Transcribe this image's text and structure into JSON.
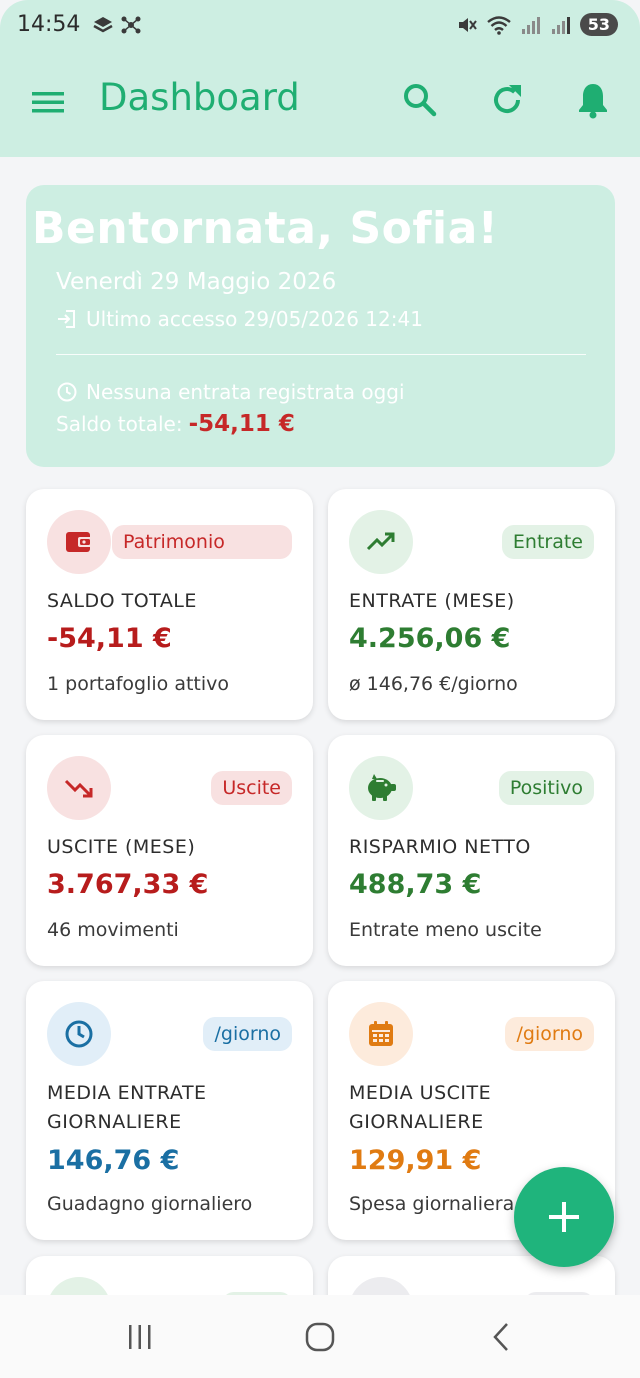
{
  "status_bar": {
    "time": "14:54",
    "battery": "53"
  },
  "app_bar": {
    "title": "Dashboard",
    "accent_color": "#1fae72",
    "background_color": "#cdeee2",
    "icons": [
      "menu-icon",
      "search-icon",
      "refresh-icon",
      "bell-icon"
    ]
  },
  "welcome": {
    "title": "Bentornata, Sofia!",
    "date": "Venerdì 29 Maggio 2026",
    "last_access": "Ultimo accesso 29/05/2026 12:41",
    "no_entries": "Nessuna entrata registrata oggi",
    "balance_label": "Saldo totale:",
    "balance_value": "-54,11 €"
  },
  "cards": [
    {
      "icon": "wallet-icon",
      "badge": "Patrimonio",
      "label": "SALDO TOTALE",
      "value": "-54,11 €",
      "sub": "1 portafoglio attivo",
      "color": "#b71c1c"
    },
    {
      "icon": "trending-up-icon",
      "badge": "Entrate",
      "label": "ENTRATE (MESE)",
      "value": "4.256,06 €",
      "sub": "ø 146,76 €/giorno",
      "color": "#2e7d32"
    },
    {
      "icon": "trending-down-icon",
      "badge": "Uscite",
      "label": "USCITE (MESE)",
      "value": "3.767,33 €",
      "sub": "46 movimenti",
      "color": "#b71c1c"
    },
    {
      "icon": "piggy-bank-icon",
      "badge": "Positivo",
      "label": "RISPARMIO NETTO",
      "value": "488,73 €",
      "sub": "Entrate meno uscite",
      "color": "#2e7d32"
    },
    {
      "icon": "clock-icon",
      "badge": "/giorno",
      "label": "MEDIA ENTRATE GIORNALIERE",
      "value": "146,76 €",
      "sub": "Guadagno giornaliero",
      "color": "#1a6fa3"
    },
    {
      "icon": "calendar-icon",
      "badge": "/giorno",
      "label": "MEDIA USCITE GIORNALIERE",
      "value": "129,91 €",
      "sub": "Spesa giornaliera",
      "color": "#e07b12"
    }
  ],
  "fab": {
    "icon": "plus-icon"
  },
  "nav_bar": {
    "icons": [
      "recents-icon",
      "home-icon",
      "back-icon"
    ]
  }
}
